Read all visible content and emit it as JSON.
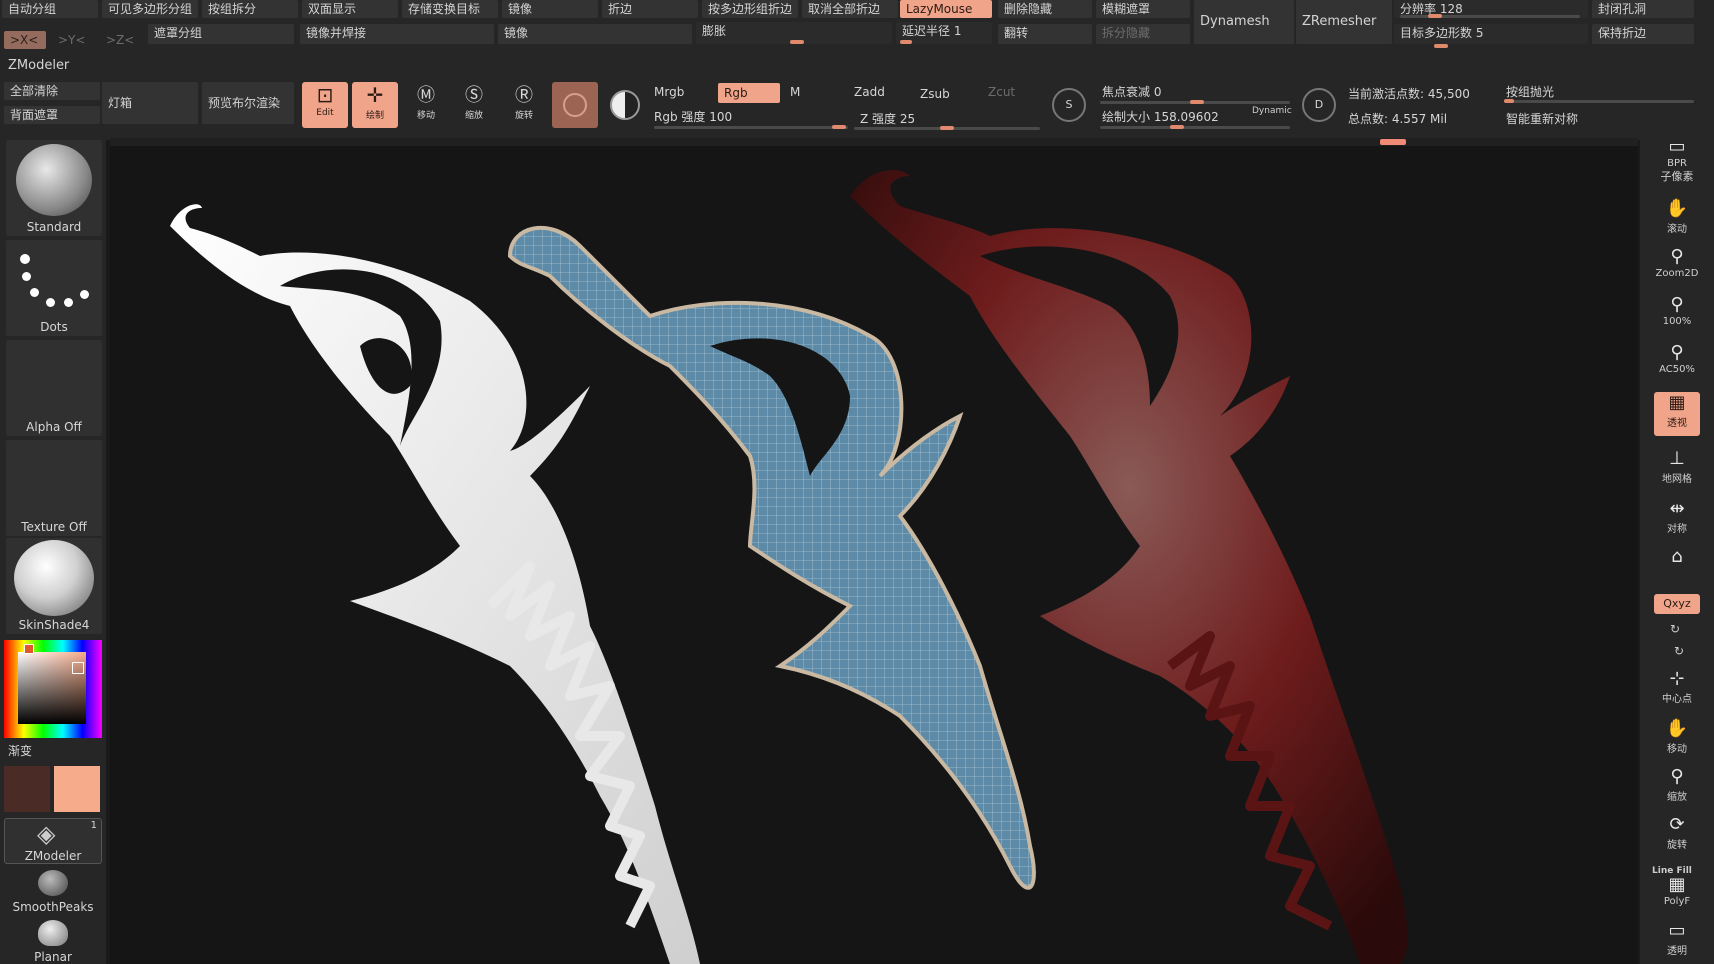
{
  "app": {
    "palette_title": "ZModeler"
  },
  "colors": {
    "accent": "#f0a58a",
    "bg": "#151515",
    "panel": "#262626",
    "button": "#333333"
  },
  "row1": [
    "自动分组",
    "可见多边形分组",
    "按组拆分",
    "双面显示",
    "存储变换目标",
    "镜像",
    "折边",
    "按多边形组折边",
    "取消全部折边",
    "LazyMouse",
    "删除隐藏",
    "模糊遮罩",
    "分辨率 128",
    "封闭孔洞"
  ],
  "row2": {
    "axis_x": ">X<",
    "axis_y": ">Y<",
    "axis_z": ">Z<",
    "mask_group": "遮罩分组",
    "mirror_weld": "镜像并焊接",
    "mirror2": "镜像",
    "inflate": "膨胀",
    "lazy_radius": "延迟半径 1",
    "flip": "翻转",
    "split_hidden": "拆分隐藏",
    "dynamesh": "Dynamesh",
    "zremesher": "ZRemesher",
    "target_poly": "目标多边形数 5",
    "keep_creases": "保持折边"
  },
  "row3": {
    "clear_all": "全部清除",
    "back_mask": "背面遮罩",
    "lightbox": "灯箱",
    "bpr_preview": "预览布尔渲染",
    "edit": "Edit",
    "draw": "绘制",
    "move": "移动",
    "scale": "缩放",
    "rotate": "旋转",
    "mrgb": "Mrgb",
    "rgb": "Rgb",
    "m": "M",
    "rgb_intensity": "Rgb 强度 100",
    "zadd": "Zadd",
    "zsub": "Zsub",
    "zcut": "Zcut",
    "z_intensity": "Z 强度 25",
    "focal_shift": "焦点衰减 0",
    "draw_size": "绘制大小 158.09602",
    "dynamic": "Dynamic",
    "active_points": "当前激活点数: 45,500",
    "total_points": "总点数: 4.557 Mil",
    "polish_groups": "按组抛光",
    "smart_resym": "智能重新对称",
    "s_label": "S",
    "d_label": "D"
  },
  "left_shelf": {
    "brush": "Standard",
    "stroke": "Dots",
    "alpha": "Alpha Off",
    "texture": "Texture Off",
    "material": "SkinShade4",
    "gradient": "渐变",
    "zmodeler": "ZModeler",
    "zmodeler_count": "1",
    "smoothpeaks": "SmoothPeaks",
    "planar": "Planar",
    "main_color": "#f6ab8a",
    "secondary_color": "#4a2b26"
  },
  "right_shelf": [
    {
      "label": "BPR",
      "icon": "bpr-icon",
      "glyph": "▭"
    },
    {
      "label": "子像素",
      "icon": "subpixel-icon",
      "glyph": ""
    },
    {
      "label": "滚动",
      "icon": "scroll-icon",
      "glyph": "✋"
    },
    {
      "label": "Zoom2D",
      "icon": "zoom2d-icon",
      "glyph": "⚲"
    },
    {
      "label": "100%",
      "icon": "zoom100-icon",
      "glyph": "⚲"
    },
    {
      "label": "AC50%",
      "icon": "ac50-icon",
      "glyph": "⚲"
    },
    {
      "label": "透视",
      "icon": "perspective-icon",
      "glyph": "▦"
    },
    {
      "label": "地网格",
      "icon": "floor-icon",
      "glyph": "⊥"
    },
    {
      "label": "对称",
      "icon": "symmetry-icon",
      "glyph": "⇹"
    },
    {
      "label": "",
      "icon": "local-icon",
      "glyph": "⌂"
    },
    {
      "label": "Qxyz",
      "icon": "xyz-icon",
      "glyph": ""
    },
    {
      "label": "中心点",
      "icon": "center-icon",
      "glyph": "⊹"
    },
    {
      "label": "移动",
      "icon": "move-icon",
      "glyph": "✋"
    },
    {
      "label": "缩放",
      "icon": "zoom-icon",
      "glyph": "⚲"
    },
    {
      "label": "旋转",
      "icon": "rotate-icon",
      "glyph": "⟳"
    },
    {
      "label": "PolyF",
      "icon": "polyf-icon",
      "glyph": "▦"
    },
    {
      "label": "透明",
      "icon": "transparent-icon",
      "glyph": "▭"
    }
  ],
  "right_shelf_extra": {
    "line_fill": "Line Fill"
  }
}
